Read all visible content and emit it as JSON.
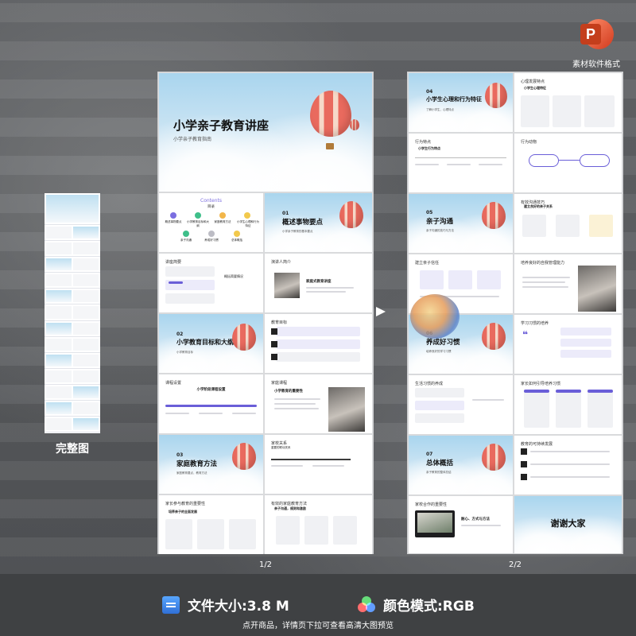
{
  "badge": {
    "label": "素材软件格式",
    "letter": "P",
    "icon": "powerpoint-icon"
  },
  "overview": {
    "label": "完整图"
  },
  "pages": {
    "left": "1/2",
    "right": "2/2"
  },
  "slides": {
    "cover": {
      "title": "小学亲子教育讲座",
      "subtitle": "小学亲子教育指南"
    },
    "contents": {
      "title": "Contents",
      "subtitle": "目录",
      "items": [
        "概述事物要点",
        "小学教育目标和大纲",
        "家庭教育方法",
        "小学生心理和行为特征",
        "亲子沟通",
        "养成好习惯",
        "总体概括"
      ]
    },
    "sec01": {
      "num": "01",
      "title": "概述事物要点",
      "sub": "小学亲子教育的基本要点"
    },
    "overview_slide": {
      "heading": "讲座简要",
      "label": "概括简要情况"
    },
    "speaker": {
      "heading": "演讲人简介",
      "label": "家庭式教育讲座"
    },
    "sec02": {
      "num": "02",
      "title": "小学教育目标和大纲",
      "sub": "小学教育目标"
    },
    "goals": {
      "heading": "教育目标"
    },
    "outline": {
      "heading": "课程设置",
      "label": "小学阶段课程设置"
    },
    "family": {
      "heading": "家庭课程",
      "label": "小学教育的重要性"
    },
    "sec03": {
      "num": "03",
      "title": "家庭教育方法",
      "sub": "家庭教育要点，教育方法"
    },
    "relation": {
      "heading": "家校关系",
      "label": "重要的联动关系"
    },
    "env": {
      "heading": "家长参与教育的重要性",
      "label": "培养亲子的全面发展"
    },
    "respect": {
      "heading": "有效的家庭教育方法",
      "label": "亲子沟通，规则和激励"
    },
    "sec04": {
      "num": "04",
      "title": "小学生心理和行为特征",
      "sub": "了解小学生，心理特点"
    },
    "psych": {
      "heading": "心理发展特点",
      "label": "小学生心理特征"
    },
    "behavior": {
      "heading": "行为特点",
      "label": "小学生行为特点"
    },
    "behavior2": {
      "heading": "行为动物"
    },
    "sec05": {
      "num": "05",
      "title": "亲子沟通",
      "sub": "亲子沟通的技巧与方法"
    },
    "comm": {
      "heading": "有效沟通技巧",
      "label": "建立良好的亲子关系"
    },
    "comm_tips": {
      "heading": "建立亲子信任"
    },
    "parenting": {
      "heading": "培养良好的自我管理能力"
    },
    "sec06": {
      "num": "06",
      "title": "养成好习惯",
      "sub": "培养良好的学习习惯"
    },
    "habit": {
      "heading": "学习习惯的培养"
    },
    "habit2": {
      "heading": "生活习惯的养成"
    },
    "habit3": {
      "heading": "家长如何引导培养习惯"
    },
    "sec07": {
      "num": "07",
      "title": "总体概括",
      "sub": "亲子教育的整体总结"
    },
    "summary": {
      "heading": "教育的可持续发展"
    },
    "final": {
      "heading": "家校合作的重要性",
      "label": "耐心、方式与方法"
    },
    "thanks": {
      "title": "谢谢大家"
    }
  },
  "footer": {
    "file_size": "文件大小:3.8 M",
    "color_mode": "颜色模式:RGB",
    "note": "点开商品，详情页下拉可查看高清大图预览"
  }
}
